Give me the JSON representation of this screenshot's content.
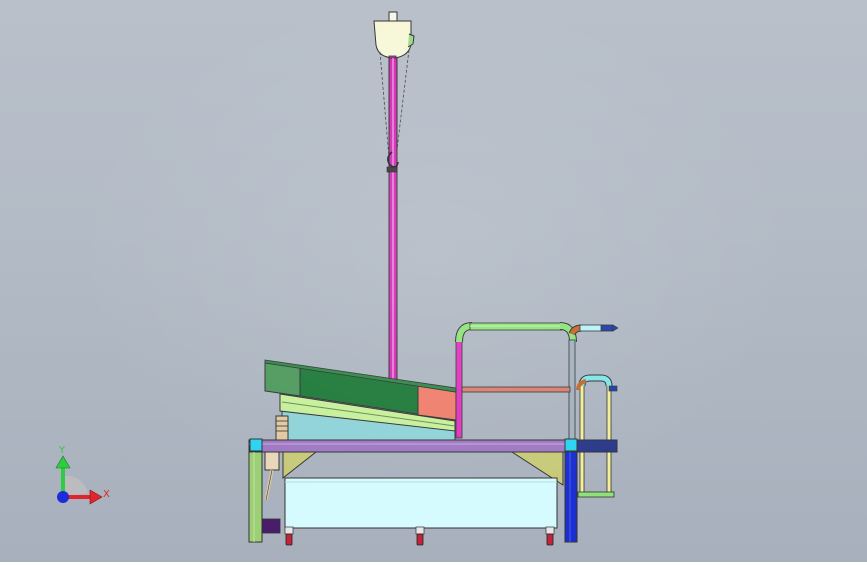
{
  "viewport": {
    "background_top": "#b9c0ca",
    "background_bottom": "#a7b0bc"
  },
  "triad": {
    "x_label": "X",
    "y_label": "Y",
    "x_color": "#e0262b",
    "y_color": "#2ecc40",
    "origin_color": "#1d2bd8"
  },
  "model": {
    "parts": [
      "hanging-motor",
      "vertical-hanger-pole",
      "tilted-bed-panel",
      "bed-support-frame",
      "upper-handrail",
      "lower-handrail",
      "table-top-beam",
      "left-leg",
      "right-leg",
      "under-storage-box",
      "caster-wheels",
      "gas-spring-actuator"
    ],
    "colors": {
      "pole": "#d12fb7",
      "bed_green": "#1f7a3a",
      "bed_green_light": "#4f9a5e",
      "bed_pink": "#ef7f6d",
      "frame_lightgreen": "#c6ef9b",
      "frame_cyan": "#8fd3d8",
      "top_beam": "#9f79c3",
      "left_leg": "#9ccf76",
      "right_leg": "#1b2fd0",
      "box": "#d6fbff",
      "support_olive": "#c7c97a",
      "rail_green": "#8fe27a",
      "rail_magenta": "#e035c0",
      "rail_salmon": "#d9806f",
      "rail_yellow": "#f3f09a",
      "rail_teal": "#7fe7ea"
    }
  }
}
